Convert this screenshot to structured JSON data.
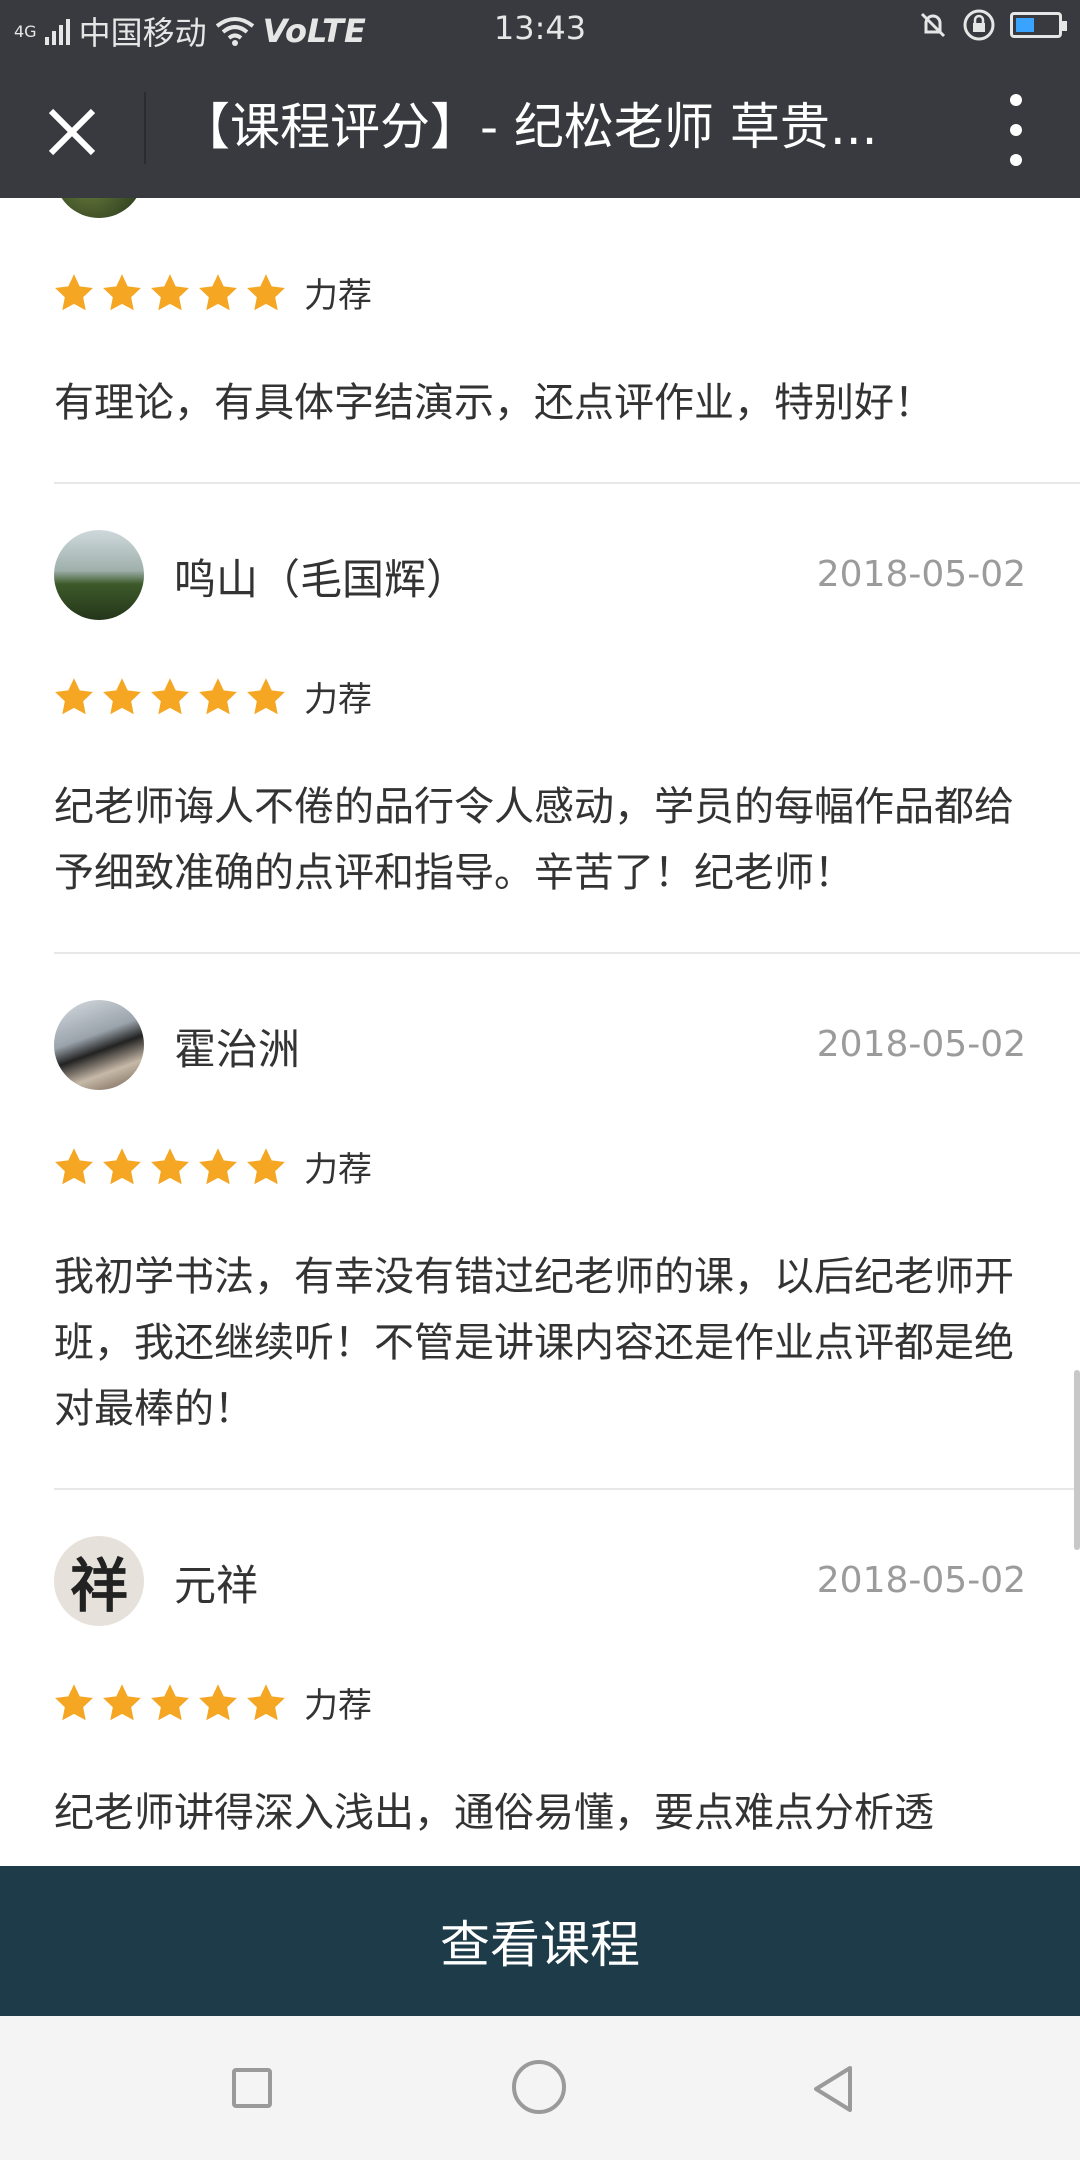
{
  "status_bar": {
    "network": "4G",
    "carrier": "中国移动",
    "volte": "VoLTE",
    "time": "13:43"
  },
  "header": {
    "title": "【课程评分】- 纪松老师 草贵..."
  },
  "reviews_top": {
    "rating_label": "力荐",
    "text": "有理论，有具体字结演示，还点评作业，特别好！"
  },
  "reviews": [
    {
      "user": "鸣山（毛国辉）",
      "date": "2018-05-02",
      "rating_label": "力荐",
      "stars": 5,
      "text": "纪老师诲人不倦的品行令人感动，学员的每幅作品都给予细致准确的点评和指导。辛苦了！纪老师！"
    },
    {
      "user": "霍治洲",
      "date": "2018-05-02",
      "rating_label": "力荐",
      "stars": 5,
      "text": "我初学书法，有幸没有错过纪老师的课，以后纪老师开班，我还继续听！不管是讲课内容还是作业点评都是绝对最棒的！"
    },
    {
      "user": "元祥",
      "avatar_glyph": "祥",
      "date": "2018-05-02",
      "rating_label": "力荐",
      "stars": 5,
      "text": "纪老师讲得深入浅出，通俗易懂，要点难点分析透"
    }
  ],
  "footer": {
    "view_course_label": "查看课程"
  },
  "colors": {
    "bar": "#393a3f",
    "star": "#f5a623",
    "button": "#1d3b48"
  }
}
